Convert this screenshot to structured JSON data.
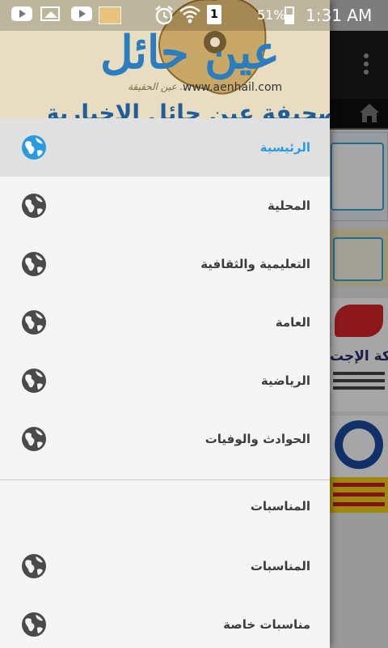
{
  "status_bar": {
    "battery_text": "51%",
    "time": "1:31 AM",
    "sim_slot": "1",
    "icons": [
      "youtube-icon",
      "gallery-icon",
      "youtube-icon",
      "app-thumbnail-icon",
      "alarm-icon",
      "wifi-icon",
      "sim-icon",
      "battery-icon"
    ]
  },
  "header": {
    "logo_text": "عين حائل",
    "url": "www.aenhail.com",
    "slogan": "عين الحقيقة ..",
    "banner": "صحيفة عين حائل الإخبارية"
  },
  "menu": {
    "items": [
      {
        "label": "الرئيسية",
        "icon": "globe-icon",
        "selected": true
      },
      {
        "label": "المحلية",
        "icon": "globe-icon"
      },
      {
        "label": "التعليمية والثقافية",
        "icon": "globe-icon"
      },
      {
        "label": "العامة",
        "icon": "globe-icon"
      },
      {
        "label": "الرياضية",
        "icon": "globe-icon"
      },
      {
        "label": "الحوادث والوفيات",
        "icon": "globe-icon"
      }
    ],
    "section_header": "المناسبات",
    "section_items": [
      {
        "label": "المناسبات",
        "icon": "globe-icon"
      },
      {
        "label": "مناسبات خاصة",
        "icon": "globe-icon"
      }
    ]
  },
  "background_app": {
    "ad_title": "شركة الإجت",
    "overflow_icon": "overflow-menu-icon",
    "home_icon": "home-icon"
  },
  "colors": {
    "accent": "#2a9be0",
    "drawer_bg": "#f5f5f5",
    "selected_bg": "#e0e0e0",
    "icon_gray": "#4a4a4a"
  }
}
